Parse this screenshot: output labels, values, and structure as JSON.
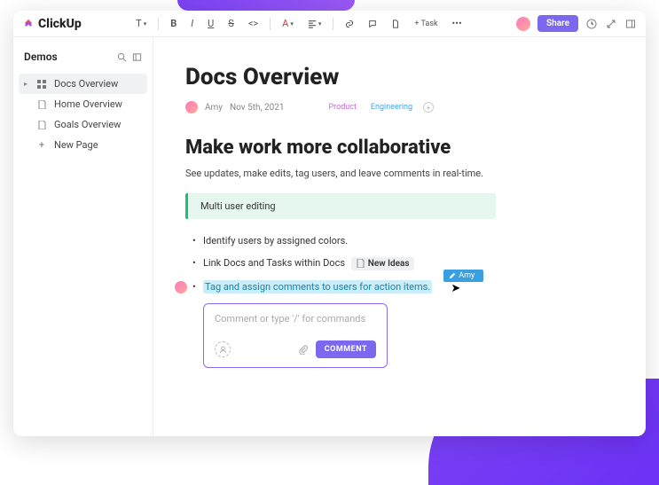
{
  "brand": "ClickUp",
  "toolbar": {
    "text_label": "T",
    "bold": "B",
    "italic": "I",
    "underline": "U",
    "strike": "S",
    "code": "<>",
    "color": "A",
    "task_label": "+ Task"
  },
  "top_right": {
    "share": "Share"
  },
  "sidebar": {
    "title": "Demos",
    "items": [
      {
        "label": "Docs Overview",
        "active": true,
        "icon": "doc"
      },
      {
        "label": "Home Overview",
        "active": false,
        "icon": "doc"
      },
      {
        "label": "Goals Overview",
        "active": false,
        "icon": "doc"
      }
    ],
    "new_page": "New Page"
  },
  "doc": {
    "title": "Docs Overview",
    "author": "Amy",
    "date": "Nov 5th, 2021",
    "tags": {
      "product": "Product",
      "engineering": "Engineering"
    },
    "h2": "Make work more collaborative",
    "sub": "See updates, make edits, tag users, and leave comments in real-time.",
    "callout": "Multi user editing",
    "bullets": {
      "b1": "Identify users by assigned colors.",
      "b2_pre": "Link Docs and Tasks within Docs",
      "b2_chip": "New Ideas",
      "b3": "Tag and assign comments to users for action items."
    },
    "tooltip_name": "Amy",
    "comment": {
      "placeholder": "Comment or type '/' for commands",
      "submit": "COMMENT"
    }
  }
}
